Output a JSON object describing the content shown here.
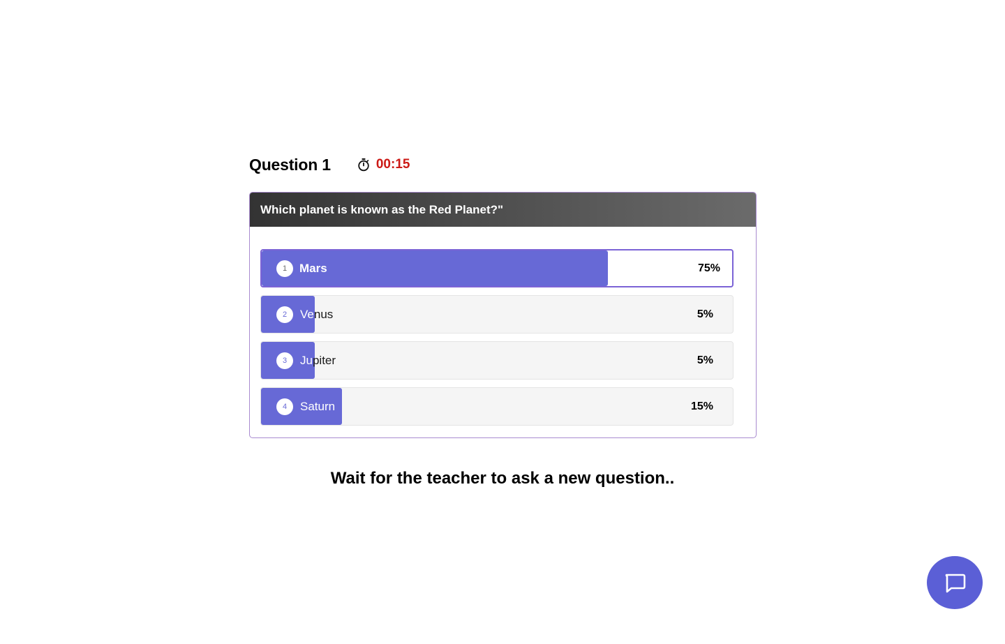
{
  "question": {
    "title": "Question 1",
    "timer": "00:15",
    "text": "Which planet is known as the Red Planet?\""
  },
  "options": [
    {
      "number": "1",
      "label": "Mars",
      "percent": "75%",
      "share": 0.75,
      "selected": true
    },
    {
      "number": "2",
      "label": "Venus",
      "percent": "5%",
      "share": 0.05,
      "selected": false
    },
    {
      "number": "3",
      "label": "Jupiter",
      "percent": "5%",
      "share": 0.05,
      "selected": false
    },
    {
      "number": "4",
      "label": "Saturn",
      "percent": "15%",
      "share": 0.15,
      "selected": false
    }
  ],
  "status_message": "Wait for the teacher to ask a new question..",
  "icons": {
    "timer": "stopwatch-icon",
    "chat": "chat-icon"
  },
  "colors": {
    "accent": "#6769d6",
    "timer": "#cc1a16",
    "selected_border": "#7b63d6",
    "chat_button": "#5b5fd6"
  }
}
